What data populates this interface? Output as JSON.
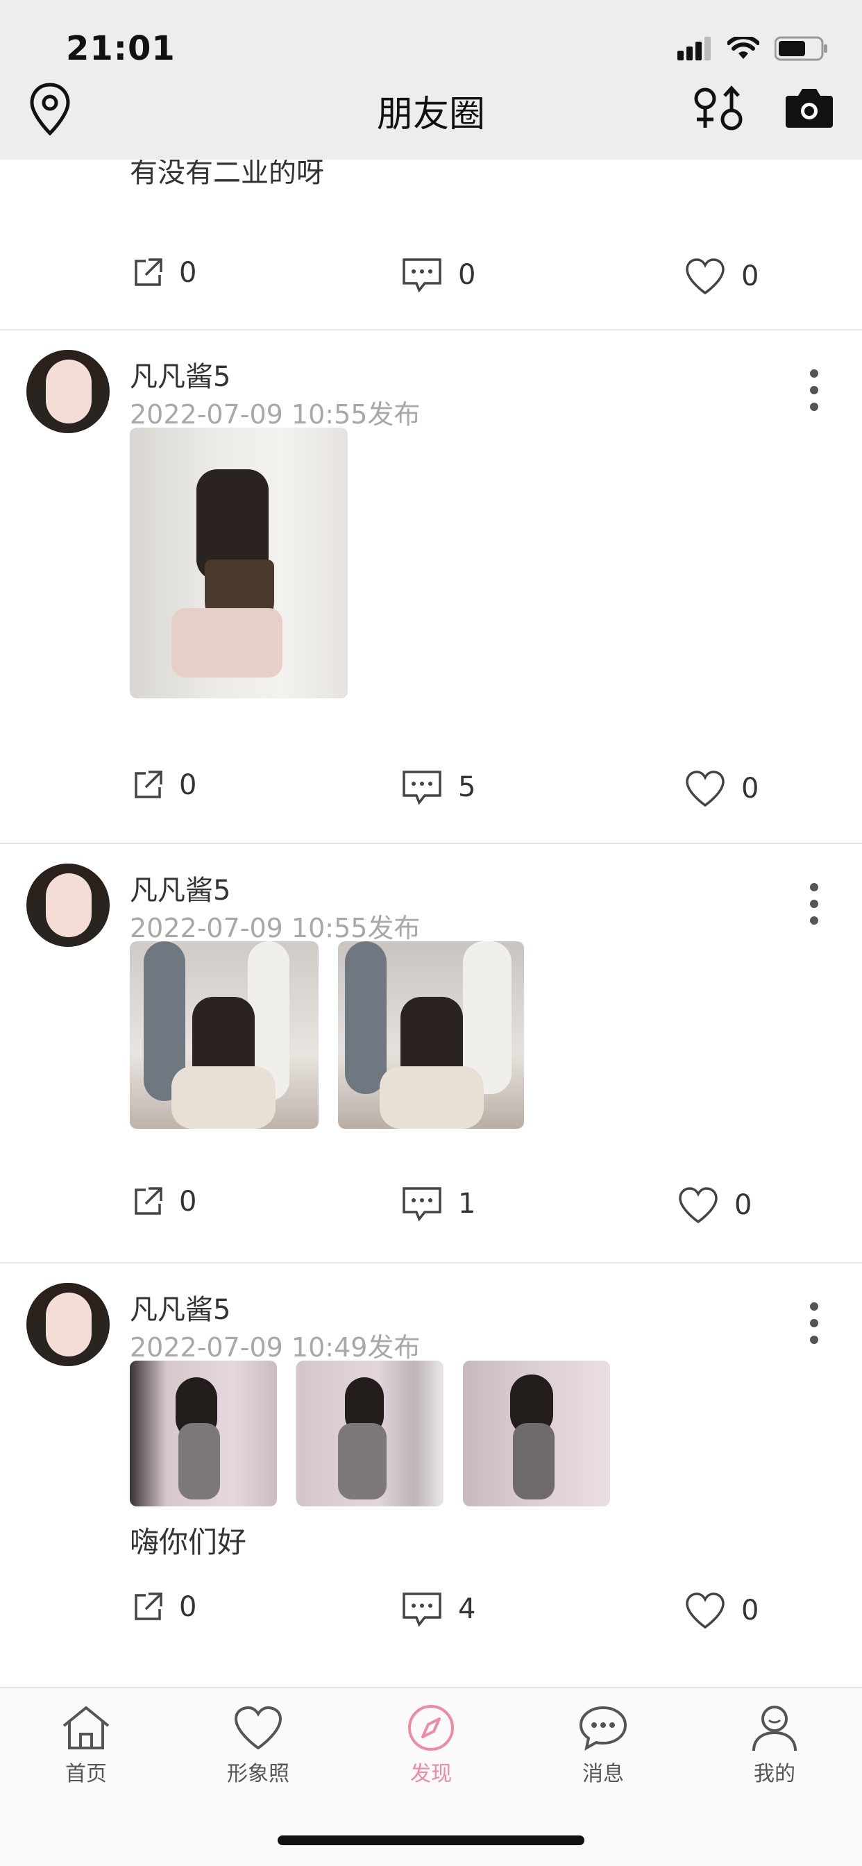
{
  "status": {
    "time": "21:01"
  },
  "nav": {
    "title": "朋友圈"
  },
  "partial_post": {
    "text": "有没有二业的呀",
    "share": "0",
    "comments": "0",
    "likes": "0"
  },
  "posts": [
    {
      "name": "凡凡酱5",
      "time": "2022-07-09 10:55发布",
      "caption": "",
      "share": "0",
      "comments": "5",
      "likes": "0"
    },
    {
      "name": "凡凡酱5",
      "time": "2022-07-09 10:55发布",
      "caption": "",
      "share": "0",
      "comments": "1",
      "likes": "0"
    },
    {
      "name": "凡凡酱5",
      "time": "2022-07-09 10:49发布",
      "caption": "嗨你们好",
      "share": "0",
      "comments": "4",
      "likes": "0"
    }
  ],
  "tabs": [
    {
      "label": "首页",
      "icon": "home-icon"
    },
    {
      "label": "形象照",
      "icon": "heart-icon"
    },
    {
      "label": "发现",
      "icon": "compass-icon"
    },
    {
      "label": "消息",
      "icon": "chat-bubble-icon"
    },
    {
      "label": "我的",
      "icon": "profile-icon"
    }
  ],
  "colors": {
    "accent": "#f08aa0",
    "header_bg": "#ededed",
    "muted_text": "#a8a8a8"
  }
}
